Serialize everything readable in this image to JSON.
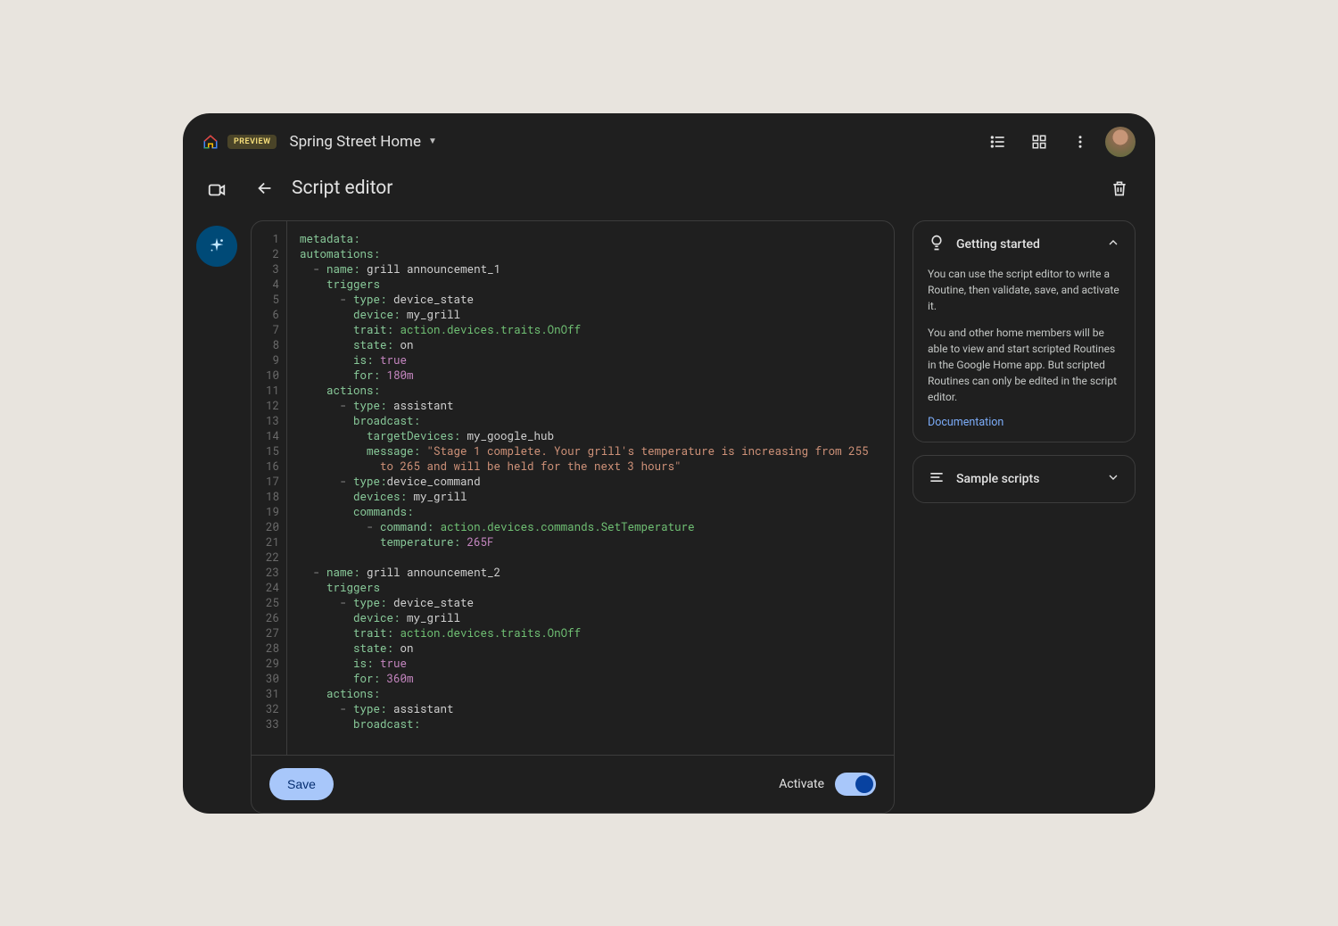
{
  "header": {
    "preview_badge": "PREVIEW",
    "home_name": "Spring Street Home"
  },
  "page": {
    "title": "Script editor"
  },
  "editor": {
    "line_count": 33,
    "save_label": "Save",
    "activate_label": "Activate",
    "activate_on": true,
    "code_lines": [
      [
        [
          "k",
          "metadata:"
        ]
      ],
      [
        [
          "k",
          "automations:"
        ]
      ],
      [
        [
          "s",
          "  "
        ],
        [
          "d",
          "- "
        ],
        [
          "k",
          "name:"
        ],
        [
          "s",
          " grill announcement_1"
        ]
      ],
      [
        [
          "s",
          "    "
        ],
        [
          "k",
          "triggers"
        ]
      ],
      [
        [
          "s",
          "      "
        ],
        [
          "d",
          "- "
        ],
        [
          "k",
          "type:"
        ],
        [
          "s",
          " device_state"
        ]
      ],
      [
        [
          "s",
          "        "
        ],
        [
          "k",
          "device:"
        ],
        [
          "s",
          " my_grill"
        ]
      ],
      [
        [
          "s",
          "        "
        ],
        [
          "k",
          "trait:"
        ],
        [
          "s",
          " "
        ],
        [
          "t",
          "action.devices.traits.OnOff"
        ]
      ],
      [
        [
          "s",
          "        "
        ],
        [
          "k",
          "state:"
        ],
        [
          "s",
          " on"
        ]
      ],
      [
        [
          "s",
          "        "
        ],
        [
          "k",
          "is:"
        ],
        [
          "s",
          " "
        ],
        [
          "b",
          "true"
        ]
      ],
      [
        [
          "s",
          "        "
        ],
        [
          "k",
          "for:"
        ],
        [
          "s",
          " "
        ],
        [
          "n",
          "180m"
        ]
      ],
      [
        [
          "s",
          "    "
        ],
        [
          "k",
          "actions:"
        ]
      ],
      [
        [
          "s",
          "      "
        ],
        [
          "d",
          "- "
        ],
        [
          "k",
          "type:"
        ],
        [
          "s",
          " assistant"
        ]
      ],
      [
        [
          "s",
          "        "
        ],
        [
          "k",
          "broadcast:"
        ]
      ],
      [
        [
          "s",
          "          "
        ],
        [
          "k",
          "targetDevices:"
        ],
        [
          "s",
          " my_google_hub"
        ]
      ],
      [
        [
          "s",
          "          "
        ],
        [
          "k",
          "message:"
        ],
        [
          "s",
          " "
        ],
        [
          "q",
          "\"Stage 1 complete. Your grill's temperature is increasing from 255"
        ]
      ],
      [
        [
          "s",
          "            "
        ],
        [
          "q",
          "to 265 and will be held for the next 3 hours\""
        ]
      ],
      [
        [
          "s",
          "      "
        ],
        [
          "d",
          "- "
        ],
        [
          "k",
          "type:"
        ],
        [
          "s",
          "device_command"
        ]
      ],
      [
        [
          "s",
          "        "
        ],
        [
          "k",
          "devices:"
        ],
        [
          "s",
          " my_grill"
        ]
      ],
      [
        [
          "s",
          "        "
        ],
        [
          "k",
          "commands:"
        ]
      ],
      [
        [
          "s",
          "          "
        ],
        [
          "d",
          "- "
        ],
        [
          "k",
          "command:"
        ],
        [
          "s",
          " "
        ],
        [
          "t",
          "action.devices.commands.SetTemperature"
        ]
      ],
      [
        [
          "s",
          "            "
        ],
        [
          "k",
          "temperature:"
        ],
        [
          "s",
          " "
        ],
        [
          "n",
          "265F"
        ]
      ],
      [
        [
          "s",
          ""
        ]
      ],
      [
        [
          "s",
          "  "
        ],
        [
          "d",
          "- "
        ],
        [
          "k",
          "name:"
        ],
        [
          "s",
          " grill announcement_2"
        ]
      ],
      [
        [
          "s",
          "    "
        ],
        [
          "k",
          "triggers"
        ]
      ],
      [
        [
          "s",
          "      "
        ],
        [
          "d",
          "- "
        ],
        [
          "k",
          "type:"
        ],
        [
          "s",
          " device_state"
        ]
      ],
      [
        [
          "s",
          "        "
        ],
        [
          "k",
          "device:"
        ],
        [
          "s",
          " my_grill"
        ]
      ],
      [
        [
          "s",
          "        "
        ],
        [
          "k",
          "trait:"
        ],
        [
          "s",
          " "
        ],
        [
          "t",
          "action.devices.traits.OnOff"
        ]
      ],
      [
        [
          "s",
          "        "
        ],
        [
          "k",
          "state:"
        ],
        [
          "s",
          " on"
        ]
      ],
      [
        [
          "s",
          "        "
        ],
        [
          "k",
          "is:"
        ],
        [
          "s",
          " "
        ],
        [
          "b",
          "true"
        ]
      ],
      [
        [
          "s",
          "        "
        ],
        [
          "k",
          "for:"
        ],
        [
          "s",
          " "
        ],
        [
          "n",
          "360m"
        ]
      ],
      [
        [
          "s",
          "    "
        ],
        [
          "k",
          "actions:"
        ]
      ],
      [
        [
          "s",
          "      "
        ],
        [
          "d",
          "- "
        ],
        [
          "k",
          "type:"
        ],
        [
          "s",
          " assistant"
        ]
      ],
      [
        [
          "s",
          "        "
        ],
        [
          "k",
          "broadcast:"
        ]
      ]
    ]
  },
  "help": {
    "getting_started": {
      "title": "Getting started",
      "p1": "You can use the script editor to write a Routine, then validate, save, and activate it.",
      "p2": "You and other home members will be able to view and start scripted Routines in the Google Home app. But scripted Routines can only be edited in the script editor.",
      "doc_label": "Documentation"
    },
    "sample_scripts": {
      "title": "Sample scripts"
    }
  }
}
